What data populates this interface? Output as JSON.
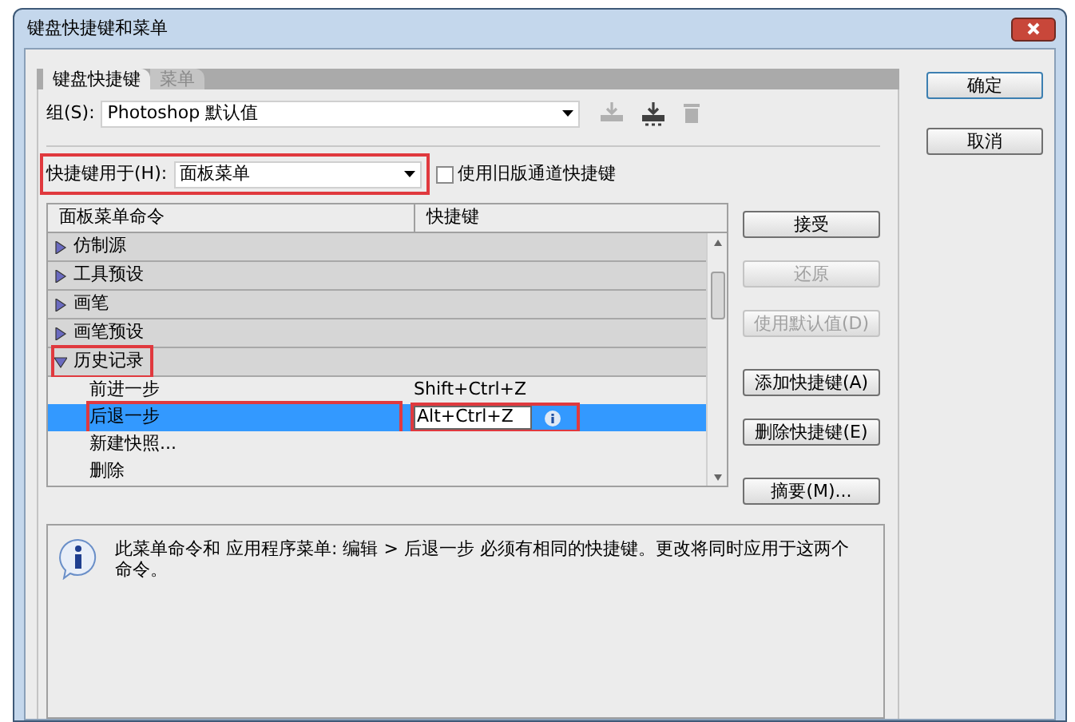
{
  "window": {
    "title": "键盘快捷键和菜单"
  },
  "tabs": [
    {
      "label": "键盘快捷键",
      "selected": true
    },
    {
      "label": "菜单",
      "selected": false
    }
  ],
  "dialog_buttons": [
    {
      "label": "确定",
      "default": true
    },
    {
      "label": "取消",
      "default": false
    }
  ],
  "set": {
    "label": "组(S):",
    "value": "Photoshop 默认值"
  },
  "set_actions": [
    {
      "kind": "save",
      "disabled": true
    },
    {
      "kind": "save-as",
      "disabled": false
    },
    {
      "kind": "delete",
      "disabled": true
    }
  ],
  "shortcuts_for": {
    "label": "快捷键用于(H):",
    "value": "面板菜单",
    "highlighted": true
  },
  "legacy_channels": {
    "label": "使用旧版通道快捷键",
    "checked": false
  },
  "table": {
    "columns": [
      "面板菜单命令",
      "快捷键"
    ],
    "rows": [
      {
        "label": "仿制源",
        "expanded": false,
        "highlighted": false,
        "children": []
      },
      {
        "label": "工具预设",
        "expanded": false,
        "highlighted": false,
        "children": []
      },
      {
        "label": "画笔",
        "expanded": false,
        "highlighted": false,
        "children": []
      },
      {
        "label": "画笔预设",
        "expanded": false,
        "highlighted": false,
        "children": []
      },
      {
        "label": "历史记录",
        "expanded": true,
        "highlighted": true,
        "children": [
          {
            "label": "前进一步",
            "shortcut": "Shift+Ctrl+Z",
            "selected": false,
            "editing": false
          },
          {
            "label": "后退一步",
            "shortcut": "Alt+Ctrl+Z",
            "selected": true,
            "editing": true
          },
          {
            "label": "新建快照...",
            "selected": false,
            "editing": false
          },
          {
            "label": "删除",
            "selected": false,
            "editing": false
          }
        ]
      }
    ]
  },
  "side_buttons": [
    {
      "label": "接受",
      "disabled": false
    },
    {
      "label": "还原",
      "disabled": true
    },
    {
      "label": "使用默认值(D)",
      "disabled": true
    },
    {
      "label": "添加快捷键(A)",
      "disabled": false
    },
    {
      "label": "删除快捷键(E)",
      "disabled": false
    },
    {
      "label": "摘要(M)...",
      "disabled": false
    }
  ],
  "info": {
    "text": "此菜单命令和 应用程序菜单: 编辑 > 后退一步 必须有相同的快捷键。更改将同时应用于这两个命令。"
  }
}
